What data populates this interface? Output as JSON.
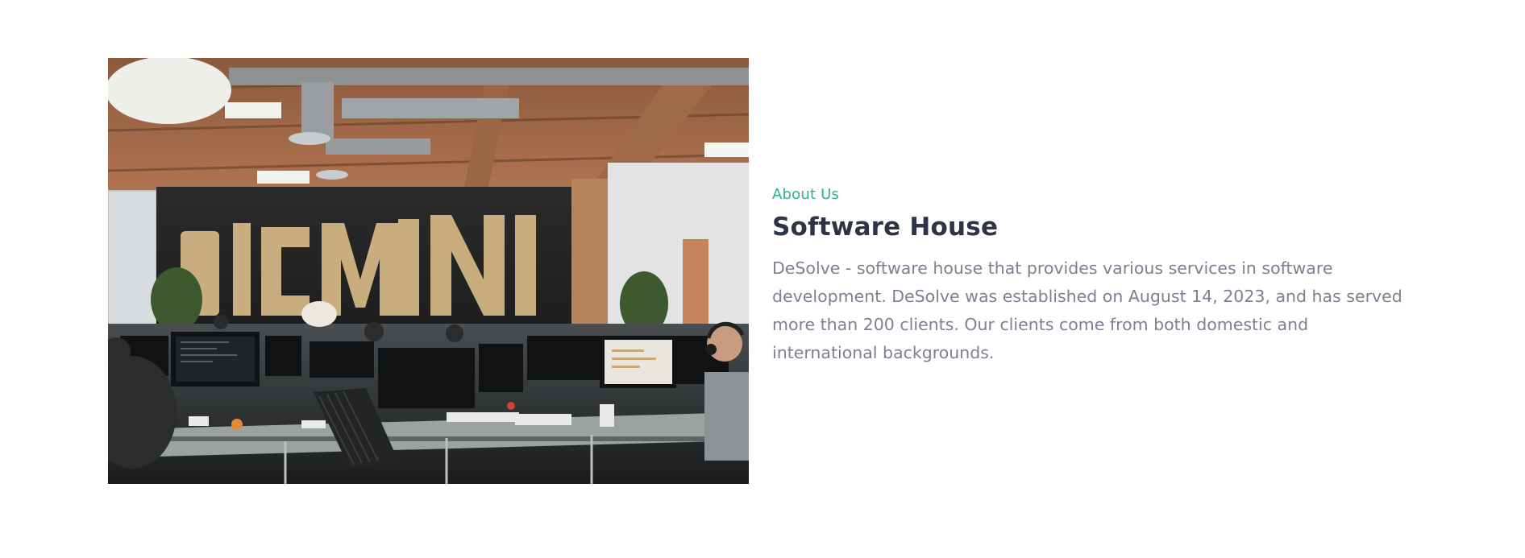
{
  "about": {
    "eyebrow": "About Us",
    "title": "Software House",
    "description": "DeSolve - software house that provides various services in software development. DeSolve was established on August 14, 2023, and has served more than 200 clients. Our clients come from both domestic and international backgrounds."
  },
  "image": {
    "subject": "office-workspace-photo",
    "wall_text": "DIGMINI"
  },
  "colors": {
    "accent": "#2fb380",
    "heading": "#2d3446",
    "body_text": "#7c8091",
    "background": "#ffffff"
  }
}
